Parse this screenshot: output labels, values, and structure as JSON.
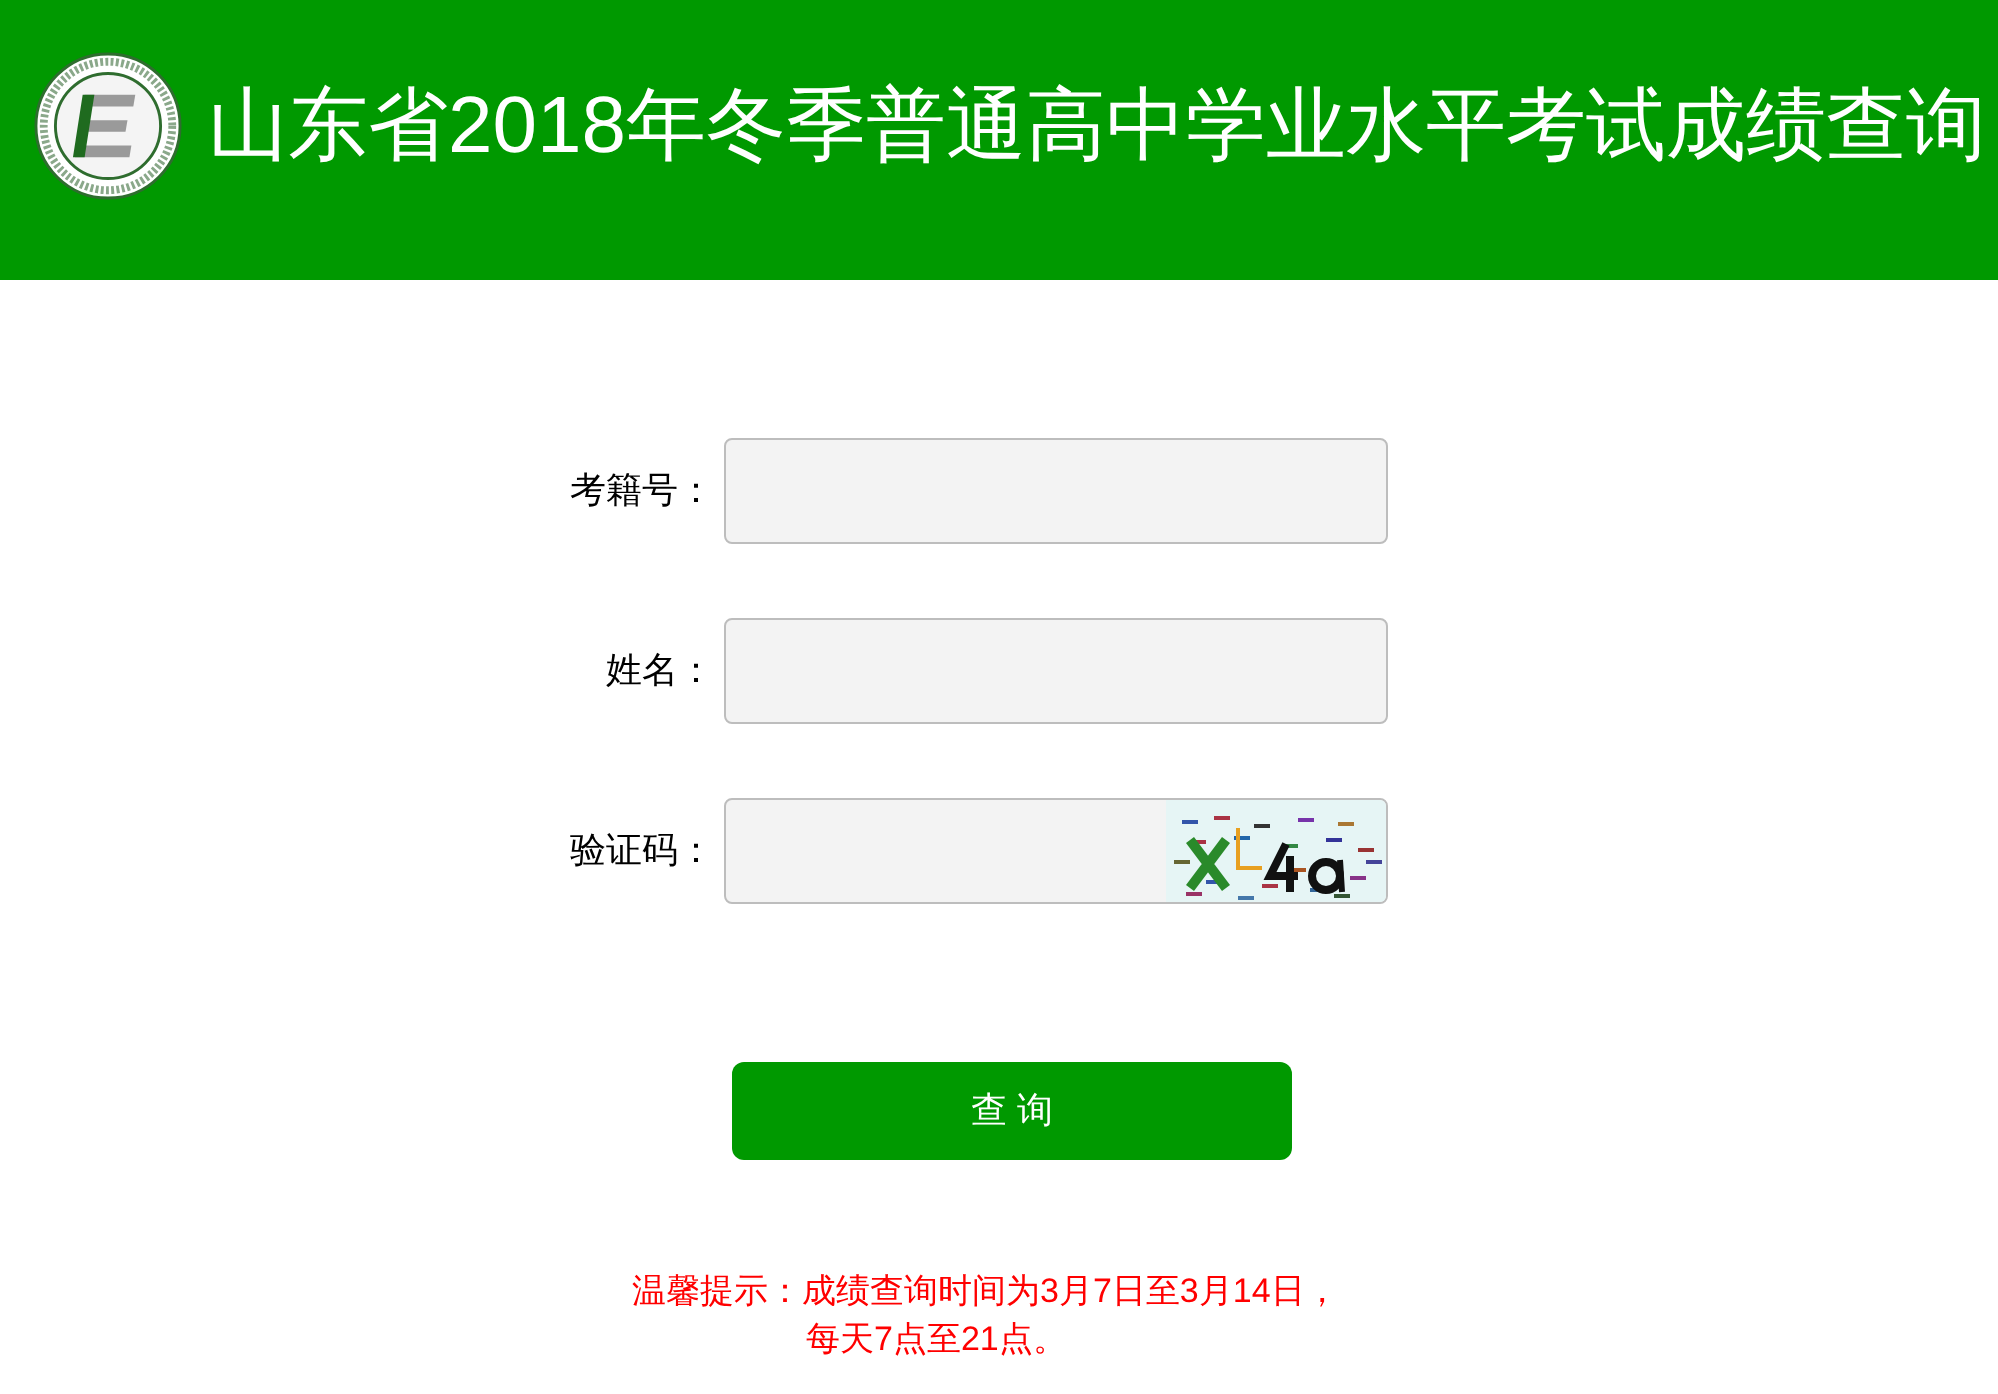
{
  "header": {
    "title": "山东省2018年冬季普通高中学业水平考试成绩查询"
  },
  "form": {
    "fields": [
      {
        "kind": "text",
        "label": "考籍号："
      },
      {
        "kind": "text",
        "label": "姓名："
      },
      {
        "kind": "captcha",
        "label": "验证码："
      }
    ],
    "submit": "查 询"
  },
  "notice": {
    "lines": [
      "温馨提示：成绩查询时间为3月7日至3月14日，",
      "每天7点至21点。"
    ]
  }
}
